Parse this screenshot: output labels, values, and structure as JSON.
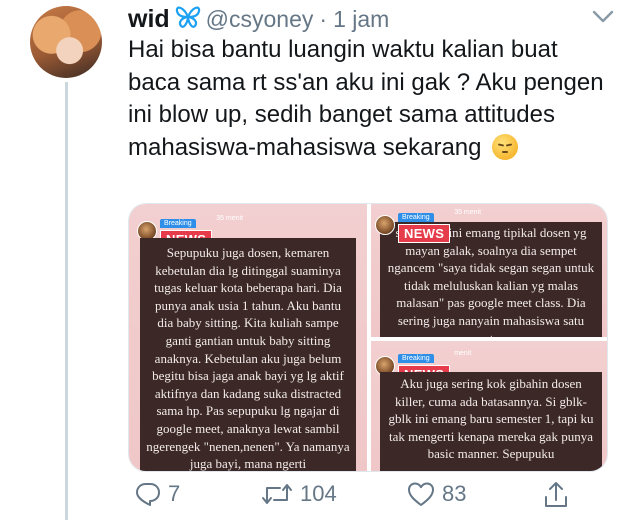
{
  "tweet": {
    "display_name": "wid",
    "handle": "@csyoney",
    "separator": "·",
    "timestamp": "1 jam",
    "text": "Hai bisa bantu luangin waktu kalian buat baca sama rt ss'an aku ini gak ? Aku pengen ini blow up, sedih banget sama attitudes mahasiswa-mahasiswa sekarang",
    "emoji": "pensive-face-emoji",
    "name_emoji": "butterfly-emoji"
  },
  "media": {
    "badge_top": "Breaking",
    "badge_news": "NEWS",
    "panel_left": {
      "time": "35 menit",
      "text": "Sepupuku juga dosen, kemaren kebetulan dia lg ditinggal suaminya tugas keluar kota beberapa hari. Dia punya anak usia 1 tahun. Aku bantu dia baby sitting. Kita kuliah sampe ganti gantian untuk baby sitting anaknya. Kebetulan aku juga belum begitu bisa jaga anak bayi yg lg aktif aktifnya dan kadang suka distracted sama hp. Pas sepupuku lg ngajar di google meet, anaknya lewat sambil ngerengek \"nenen,nenen\". Ya namanya juga bayi, mana ngerti"
    },
    "panel_top_right": {
      "time": "35 menit",
      "text": "sepupuku ini emang tipikal dosen yg mayan galak, soalnya dia sempet ngancem \"saya tidak segan segan untuk tidak meluluskan kalian yg malas malasan\" pas google meet class. Dia sering juga nanyain mahasiswa satu satu."
    },
    "panel_bottom_right": {
      "time": "menit",
      "text": "Aku juga sering kok gibahin dosen killer, cuma ada batasannya. Si gblk-gblk ini emang baru semester 1, tapi ku tak mengerti kenapa mereka gak punya basic manner. Sepupuku"
    }
  },
  "actions": {
    "reply_count": "7",
    "retweet_count": "104",
    "like_count": "83"
  },
  "colors": {
    "text": "#14171a",
    "secondary": "#657786",
    "butterfly": "#1da1f2",
    "panel_bg": "#f2cfd0",
    "dark_box": "#3b2827",
    "news_red": "#e63b4a",
    "breaking_blue": "#2f8fe8"
  }
}
